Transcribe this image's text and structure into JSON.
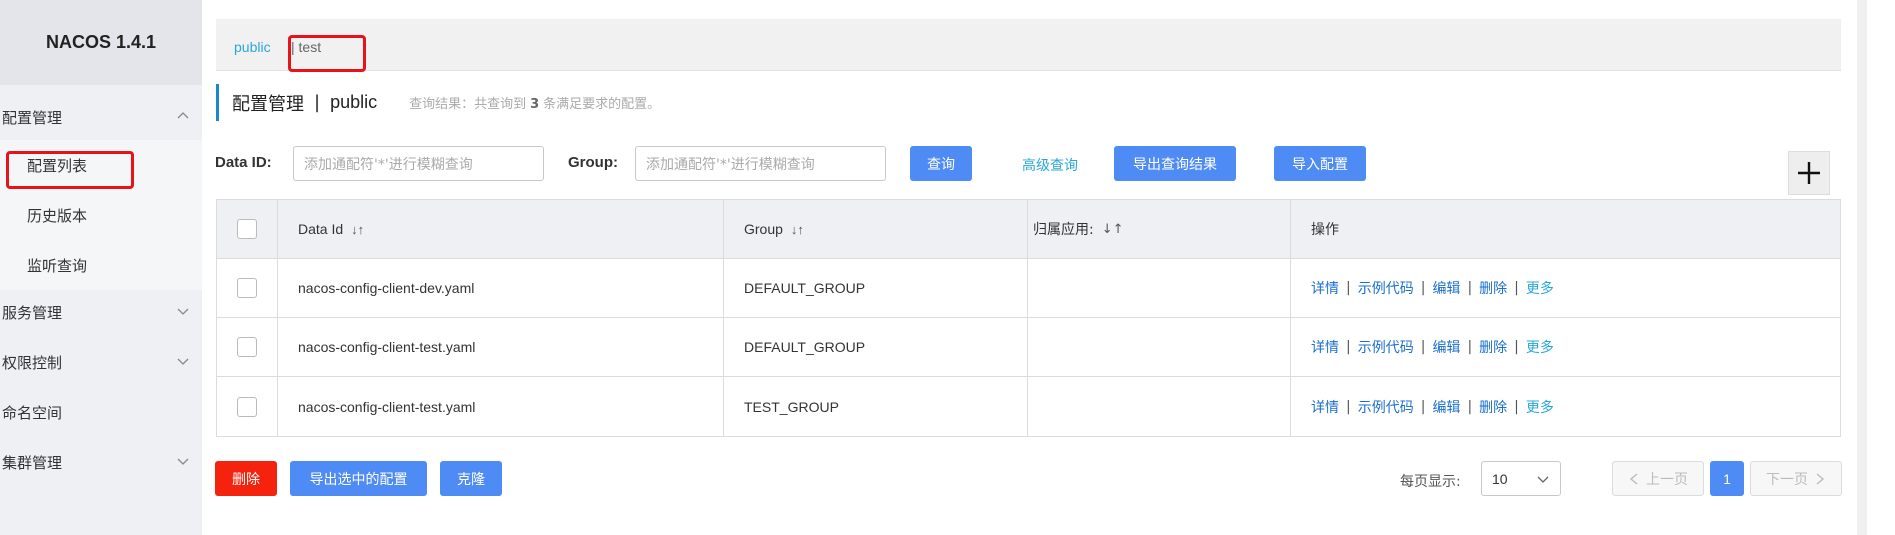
{
  "app": {
    "logo": "NACOS 1.4.1"
  },
  "sidebar": {
    "config_mgmt": "配置管理",
    "config_list": "配置列表",
    "history": "历史版本",
    "listener_query": "监听查询",
    "service_mgmt": "服务管理",
    "access_control": "权限控制",
    "namespace": "命名空间",
    "cluster_mgmt": "集群管理"
  },
  "namespaces": {
    "public": "public",
    "test": "| test"
  },
  "header": {
    "title": "配置管理",
    "separator": "|",
    "namespace": "public",
    "result_prefix": "查询结果：共查询到",
    "result_count": "3",
    "result_suffix": "条满足要求的配置。"
  },
  "search": {
    "dataid_label": "Data ID:",
    "dataid_placeholder": "添加通配符'*'进行模糊查询",
    "group_label": "Group:",
    "group_placeholder": "添加通配符'*'进行模糊查询",
    "query_btn": "查询",
    "advanced_query": "高级查询",
    "export_results": "导出查询结果",
    "import_config": "导入配置",
    "add_icon": "+"
  },
  "table": {
    "headers": {
      "dataid": "Data Id",
      "group": "Group",
      "app": "归属应用:",
      "ops": "操作"
    },
    "sort_icon": "↓↑",
    "rows": [
      {
        "dataid": "nacos-config-client-dev.yaml",
        "group": "DEFAULT_GROUP",
        "app": ""
      },
      {
        "dataid": "nacos-config-client-test.yaml",
        "group": "DEFAULT_GROUP",
        "app": ""
      },
      {
        "dataid": "nacos-config-client-test.yaml",
        "group": "TEST_GROUP",
        "app": ""
      }
    ],
    "ops": {
      "detail": "详情",
      "sample": "示例代码",
      "edit": "编辑",
      "delete": "删除",
      "more": "更多"
    }
  },
  "footer": {
    "delete_btn": "删除",
    "export_selected": "导出选中的配置",
    "clone": "克隆",
    "page_size_label": "每页显示:",
    "page_size": "10",
    "prev": "上一页",
    "page": "1",
    "next": "下一页"
  },
  "colors": {
    "accent": "#4f8bf5",
    "danger": "#f5220d",
    "link": "#28a8d8",
    "highlight": "#e8131a"
  }
}
